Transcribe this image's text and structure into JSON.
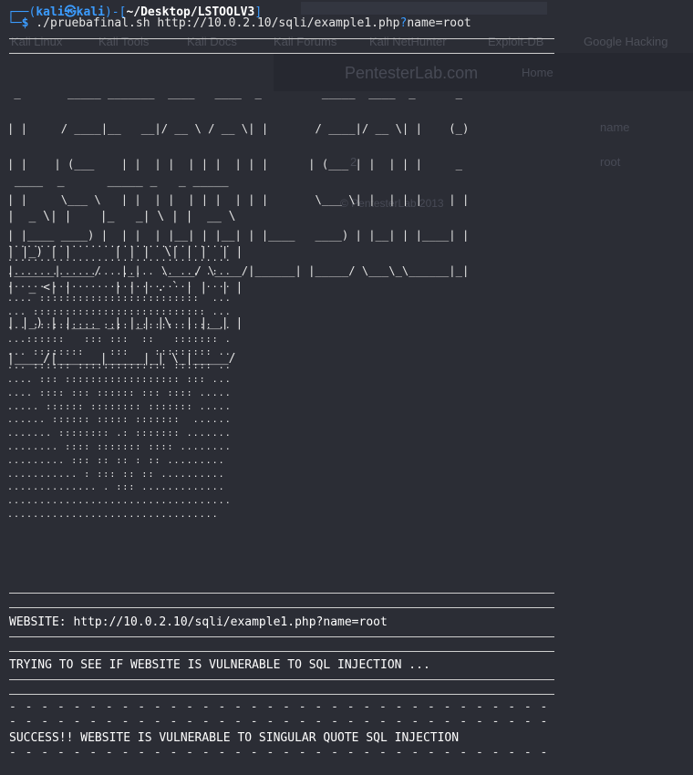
{
  "background_page": {
    "bookmarks": [
      "Kali Linux",
      "Kali Tools",
      "Kali Docs",
      "Kali Forums",
      "Kali NetHunter",
      "Exploit-DB",
      "Google Hacking"
    ],
    "site_title": "PentesterLab.com",
    "nav_home": "Home",
    "table_header": "name",
    "row_id": "2",
    "row_name": "root",
    "footer": "© PentesterLab 2013"
  },
  "terminal": {
    "prompt": {
      "user_host_open": "┌──(",
      "user": "kali",
      "at": "㉿",
      "host": "kali",
      "mid": ")-[",
      "path": "~/Desktop/LSTOOLV3",
      "close": "]",
      "second_prefix": "└─",
      "symbol": "$",
      "command_a": " ./pruebafinal.sh http://10.0.2.10/sqli/example1.php",
      "command_q": "?",
      "command_b": "name=root"
    },
    "banner_title": [
      " _       _____ _______  ____   ____  _         _____  ____  _      _ ",
      "| |     / ____|__   __|/ __ \\ / __ \\| |       / ____|/ __ \\| |    (_)",
      "| |    | (___    | |  | |  | | |  | | |      | (___ | |  | | |     _ ",
      "| |     \\___ \\   | |  | |  | | |  | | |       \\___ \\| |  | | |    | |",
      "| |____ ____) |  | |  | |__| | |__| | |____   ____) | |__| | |____| |",
      "|______|_____/   |_|   \\____/ \\____/|______| |_____/ \\___\\_\\______|_|"
    ],
    "banner_sub": [
      " ____  _      _____ _   _ _____  ",
      "|  _ \\| |    |_   _| \\ | |  __ \\ ",
      "| |_) | |      | | |  \\| | |  | |",
      "|  _ <| |      | | | . ` | |  | |",
      "| |_) | |____ _| |_| |\\  | |__| |",
      "|____/|______|_____|_| \\_|_____/ "
    ],
    "ascii_art": [
      "...................................",
      "...................................",
      "....................... .. ... .:..",
      "...... ......................  ....",
      ".... :::::::::::::::::::::::::  ...",
      "... ::::::::::::::::::::::::::: ...",
      "... :::::::::: :::: :::::::::::: ..",
      "...::::::   ::: :::  ::   ::::::: .",
      "... ::::::::    :::    ::::::::: ..",
      "... :::::: :::::::::::::: :::::: ..",
      ".... ::: :::::::::::::::::: ::: ...",
      ".... :::: ::: :::::: ::: :::: .....",
      "..... :::::: :::::::: ::::::: .....",
      "...... :::::: ::::: :::::::  ......",
      "....... :::::::: .: ::::::: .......",
      "........ :::: ::::::: :::: ........",
      "......... ::: :: :: : :: .........",
      "........... : ::: :: :: ..........",
      ".............. . ::: .............",
      "...................................",
      "................................."
    ],
    "website_line": "WEBSITE: http://10.0.2.10/sqli/example1.php?name=root",
    "trying_line": "TRYING TO SEE IF WEBSITE IS VULNERABLE TO SQL INJECTION ...",
    "dash_row": "- - - - - - - - - - - - - - - - - - - - - - - - - - - - - - - - - - - - - - - - - - - - - -",
    "success_line": "SUCCESS!! WEBSITE IS VULNERABLE TO SINGULAR QUOTE SQL INJECTION"
  },
  "colors": {
    "background": "#2b2d35",
    "prompt_accent": "#3b9cff",
    "text": "#e6e6e6"
  }
}
